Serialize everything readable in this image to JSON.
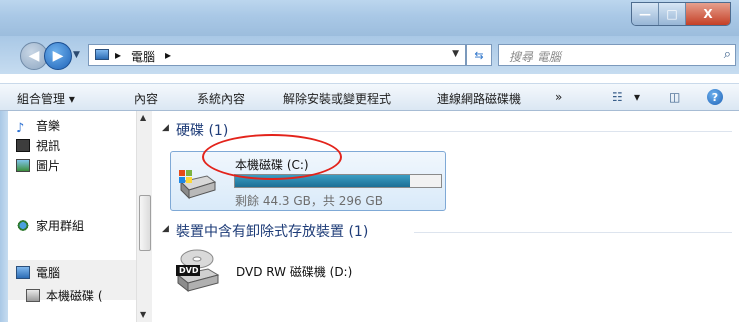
{
  "window": {
    "controls": {
      "minimize": "—",
      "maximize": "□",
      "close": "X"
    }
  },
  "address": {
    "back_icon": "back-arrow",
    "forward_icon": "forward-arrow",
    "crumb_current": "電腦",
    "crumb_arrow": "▸",
    "search_placeholder": "搜尋 電腦"
  },
  "toolbar": {
    "organize": "組合管理 ▾",
    "properties": "內容",
    "system_properties": "系統內容",
    "uninstall": "解除安裝或變更程式",
    "map_drive": "連線網路磁碟機",
    "more": "»",
    "view_dropdown": "▾"
  },
  "nav": {
    "music": "音樂",
    "videos": "視訊",
    "pictures": "圖片",
    "homegroup": "家用群組",
    "computer": "電腦",
    "local_disk": "本機磁碟 (",
    "icons": {
      "music": "music-note-icon",
      "videos": "video-icon",
      "pictures": "picture-icon",
      "homegroup": "homegroup-icon",
      "computer": "computer-icon",
      "local_disk": "drive-icon"
    }
  },
  "content": {
    "hdd_group": "硬碟 (1)",
    "removable_group": "裝置中含有卸除式存放裝置 (1)",
    "drive_c": {
      "name": "本機磁碟 (C:)",
      "free_text": "剩餘 44.3 GB，共 296 GB",
      "used_fraction": 0.85
    },
    "drive_d": {
      "name": "DVD RW 磁碟機 (D:)",
      "badge": "DVD"
    }
  },
  "colors": {
    "highlight_oval": "#e3231b",
    "usage_bar": "#1d6f95",
    "group_text": "#1e3c78"
  }
}
